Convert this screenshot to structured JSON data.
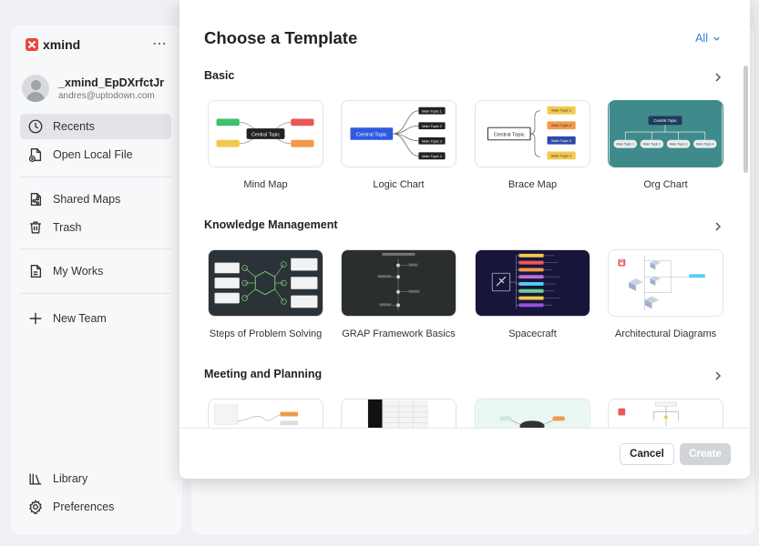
{
  "app": {
    "brand": "xmind",
    "more": "⋯"
  },
  "user": {
    "name": "_xmind_EpDXrfctJr",
    "email": "andres@uptodown.com"
  },
  "sidebar": {
    "items": [
      {
        "label": "Recents",
        "icon": "clock-icon"
      },
      {
        "label": "Open Local File",
        "icon": "file-open-icon"
      },
      {
        "label": "Shared Maps",
        "icon": "shared-file-icon"
      },
      {
        "label": "Trash",
        "icon": "trash-icon"
      },
      {
        "label": "My Works",
        "icon": "document-icon"
      },
      {
        "label": "New Team",
        "icon": "plus-icon"
      },
      {
        "label": "Library",
        "icon": "library-icon"
      },
      {
        "label": "Preferences",
        "icon": "gear-icon"
      }
    ]
  },
  "modal": {
    "title": "Choose a Template",
    "filter": "All",
    "sections": [
      {
        "title": "Basic",
        "templates": [
          "Mind Map",
          "Logic Chart",
          "Brace Map",
          "Org Chart"
        ]
      },
      {
        "title": "Knowledge Management",
        "templates": [
          "Steps of Problem Solving",
          "GRAP Framework Basics",
          "Spacecraft",
          "Architectural Diagrams"
        ]
      },
      {
        "title": "Meeting and Planning",
        "templates": [
          "",
          "",
          "",
          ""
        ]
      }
    ],
    "thumb_text": {
      "central": "Central Topic",
      "main1": "Main Topic 1",
      "main2": "Main Topic 2",
      "main3": "Main Topic 3",
      "main4": "Main Topic 4"
    },
    "cancel": "Cancel",
    "create": "Create"
  },
  "colors": {
    "accent": "#3b7ddd",
    "orgchart_bg": "#3f8a8a",
    "brand": "#e8473a"
  }
}
